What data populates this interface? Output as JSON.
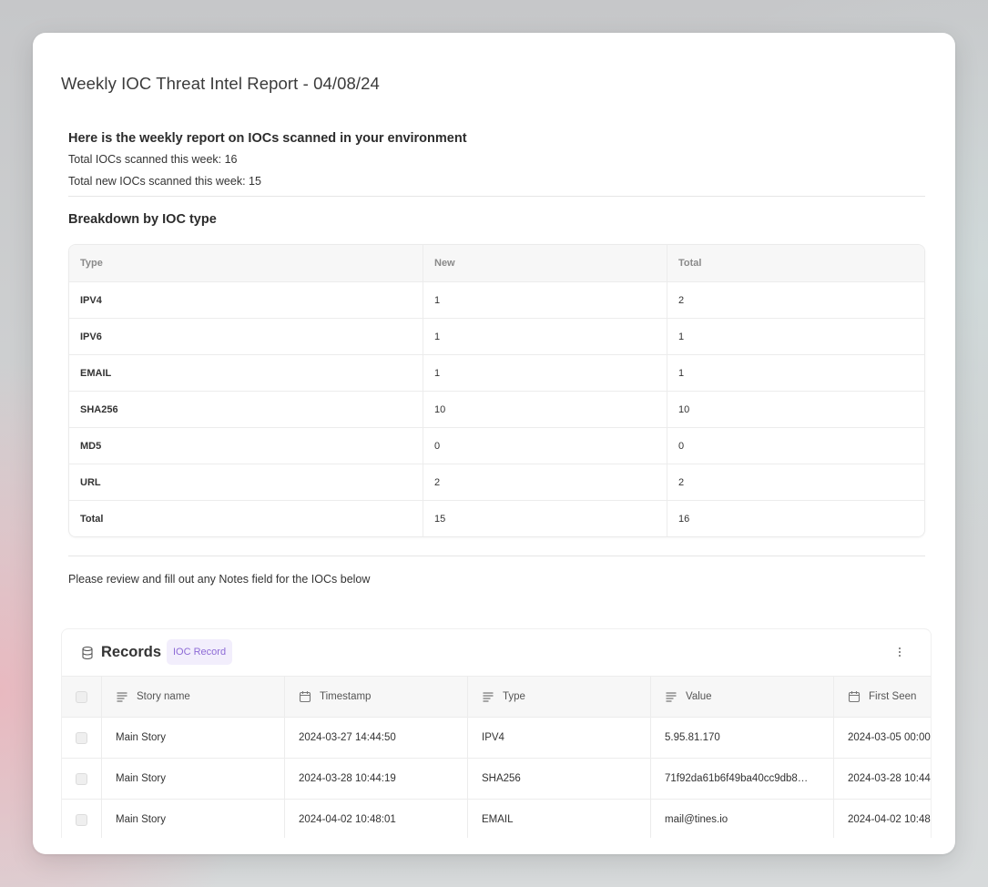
{
  "page": {
    "title": "Weekly IOC Threat Intel Report - 04/08/24"
  },
  "report": {
    "heading": "Here is the weekly report on IOCs scanned in your environment",
    "total_scanned": "Total IOCs scanned this week: 16",
    "total_new": "Total new IOCs scanned this week: 15",
    "breakdown_title": "Breakdown by IOC type",
    "review_text": "Please review and fill out any Notes field for the IOCs below"
  },
  "breakdown_table": {
    "headers": [
      "Type",
      "New",
      "Total"
    ],
    "rows": [
      [
        "IPV4",
        "1",
        "2"
      ],
      [
        "IPV6",
        "1",
        "1"
      ],
      [
        "EMAIL",
        "1",
        "1"
      ],
      [
        "SHA256",
        "10",
        "10"
      ],
      [
        "MD5",
        "0",
        "0"
      ],
      [
        "URL",
        "2",
        "2"
      ],
      [
        "Total",
        "15",
        "16"
      ]
    ]
  },
  "records": {
    "title": "Records",
    "badge": "IOC Record",
    "columns": [
      {
        "label": "Story name",
        "icon": "text-lines-icon"
      },
      {
        "label": "Timestamp",
        "icon": "calendar-icon"
      },
      {
        "label": "Type",
        "icon": "text-lines-icon"
      },
      {
        "label": "Value",
        "icon": "text-lines-icon"
      },
      {
        "label": "First Seen",
        "icon": "calendar-icon"
      }
    ],
    "rows": [
      [
        "Main Story",
        "2024-03-27 14:44:50",
        "IPV4",
        "5.95.81.170",
        "2024-03-05 00:00"
      ],
      [
        "Main Story",
        "2024-03-28 10:44:19",
        "SHA256",
        "71f92da61b6f49ba40cc9db8…",
        "2024-03-28 10:44"
      ],
      [
        "Main Story",
        "2024-04-02 10:48:01",
        "EMAIL",
        "mail@tines.io",
        "2024-04-02 10:48"
      ]
    ]
  },
  "colors": {
    "badge_bg": "#f2eefc",
    "badge_text": "#8d6ad6",
    "card_bg": "#ffffff"
  }
}
